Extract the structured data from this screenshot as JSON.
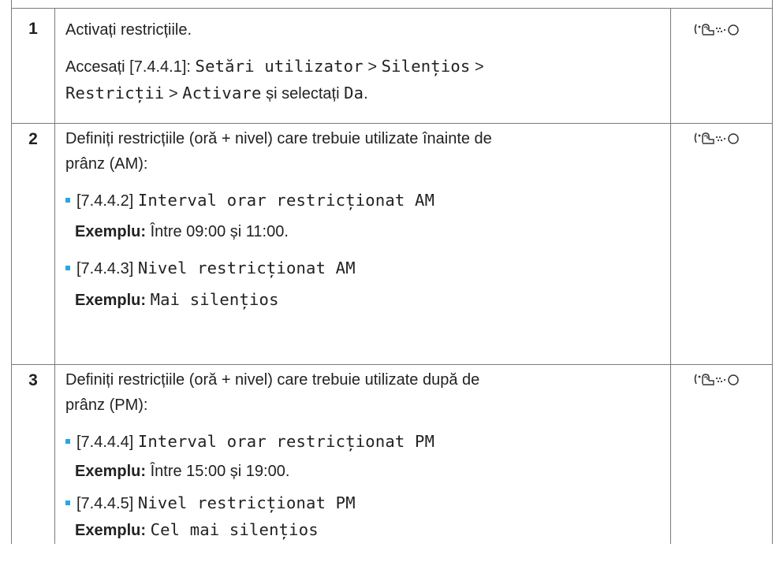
{
  "rows": [
    {
      "num": "1",
      "line1": "Activați restricțiile.",
      "acc_prefix": "Accesați [7.4.4.1]:",
      "acc_m1": "Setări utilizator",
      "sep": ">",
      "acc_m2": "Silențios",
      "acc_m3": "Restricții",
      "acc_m4": "Activare",
      "acc_mid": "și selectați",
      "acc_m5": "Da",
      "acc_end": "."
    },
    {
      "num": "2",
      "line1": "Definiți restricțiile (oră + nivel) care trebuie utilizate înainte de",
      "line2": "prânz (AM):",
      "b1_code": "[7.4.4.2]",
      "b1_text": "Interval orar restricționat AM",
      "b1_ex_label": "Exemplu:",
      "b1_ex": "Între 09:00 și 11:00.",
      "b2_code": "[7.4.4.3]",
      "b2_text": "Nivel restricționat AM",
      "b2_ex_label": "Exemplu:",
      "b2_ex": "Mai silențios"
    },
    {
      "num": "3",
      "line1": "Definiți restricțiile (oră + nivel) care trebuie utilizate după de",
      "line2": "prânz (PM):",
      "b1_code": "[7.4.4.4]",
      "b1_text": "Interval orar restricționat PM",
      "b1_ex_label": "Exemplu:",
      "b1_ex": "Între 15:00 și 19:00.",
      "b2_code": "[7.4.4.5]",
      "b2_text": "Nivel restricționat PM",
      "b2_ex_label": "Exemplu:",
      "b2_ex": "Cel mai silențios"
    }
  ],
  "icon": "user-interface-icon"
}
